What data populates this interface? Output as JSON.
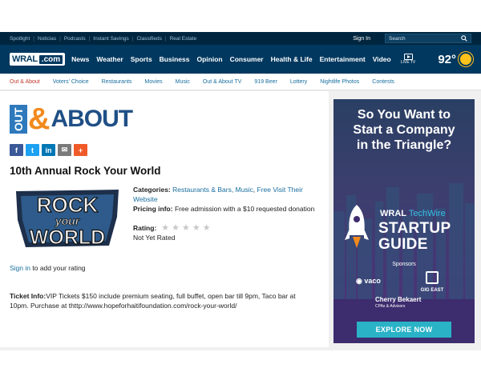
{
  "utility": {
    "links": [
      "Spotlight",
      "Noticias",
      "Podcasts",
      "Instant Savings",
      "Classifieds",
      "Real Estate"
    ],
    "signin": "Sign In",
    "search_placeholder": "Search"
  },
  "nav": {
    "logo_wral": "WRAL",
    "logo_com": ".com",
    "items": [
      "News",
      "Weather",
      "Sports",
      "Business",
      "Opinion",
      "Consumer",
      "Health & Life",
      "Entertainment",
      "Video"
    ],
    "livetv": "LIVE TV",
    "temperature": "92°"
  },
  "subnav": {
    "items": [
      "Out & About",
      "Voters' Choice",
      "Restaurants",
      "Movies",
      "Music",
      "Out & About TV",
      "919 Beer",
      "Lottery",
      "Nightlife Photos",
      "Contests"
    ],
    "active_index": 0
  },
  "logo": {
    "out": "OUT",
    "amp": "&",
    "about": "ABOUT"
  },
  "share_buttons": [
    {
      "icon": "facebook-icon",
      "glyph": "f",
      "color": "#3b5998"
    },
    {
      "icon": "twitter-icon",
      "glyph": "t",
      "color": "#1da1f2"
    },
    {
      "icon": "linkedin-icon",
      "glyph": "in",
      "color": "#0077b5"
    },
    {
      "icon": "email-icon",
      "glyph": "✉",
      "color": "#7a7a7a"
    },
    {
      "icon": "more-icon",
      "glyph": "+",
      "color": "#f05a28"
    }
  ],
  "event": {
    "title": "10th Annual Rock Your World",
    "image_text": [
      "ROCK",
      "your",
      "WORLD"
    ],
    "categories_label": "Categories:",
    "categories": "Restaurants & Bars, Music",
    "visit_link": "Free Visit Their Website",
    "pricing_label": "Pricing info:",
    "pricing": "Free admission with a $10 requested donation",
    "rating_label": "Rating:",
    "rating_stars": 0,
    "rating_status": "Not Yet Rated",
    "signin_link": "Sign in",
    "signin_text": "to add your rating",
    "ticket_label": "Ticket Info:",
    "ticket_text": "VIP Tickets $150 include premium seating, full buffet, open bar till 9pm, Taco bar at 10pm. Purchase at thttp://www.hopeforhaitifoundation.com/rock-your-world/"
  },
  "ad": {
    "headline": [
      "So You Want to",
      "Start a Company",
      "in the Triangle?"
    ],
    "brand_wral": "WRAL",
    "brand_techwire": "TechWire",
    "startup": "STARTUP",
    "guide": "GUIDE",
    "sponsors_label": "Sponsors",
    "sponsors": [
      "vaco",
      "GIG EAST",
      "Cherry Bekaert"
    ],
    "sponsor_sub": "CPAs & Advisors",
    "cta": "EXPLORE NOW"
  }
}
